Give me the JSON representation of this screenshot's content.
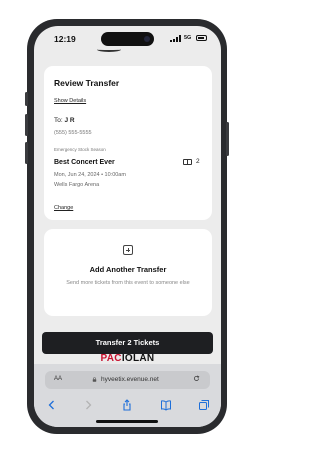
{
  "status_bar": {
    "time": "12:19",
    "network": "5G"
  },
  "review": {
    "title": "Review Transfer",
    "show_details": "Show Details",
    "to_label": "To:",
    "recipient_name": "J R",
    "recipient_phone": "(555) 555-5555",
    "season": "Emergency Stock Season",
    "event_name": "Best Concert Ever",
    "event_datetime": "Mon, Jun 24, 2024 • 10:00am",
    "venue": "Wells Fargo Arena",
    "ticket_count": "2",
    "change_link": "Change"
  },
  "add_transfer": {
    "title": "Add Another Transfer",
    "description": "Send more tickets from this event to someone else"
  },
  "cta": {
    "label": "Transfer 2 Tickets"
  },
  "brand": {
    "part1": "PAC",
    "part2": "IOLAN"
  },
  "browser": {
    "aa_label": "AA",
    "url": "hyveetix.evenue.net"
  },
  "colors": {
    "brand_red": "#c8102e",
    "button_dark": "#1e1f22",
    "card_bg": "#ffffff",
    "page_bg": "#ececec"
  }
}
